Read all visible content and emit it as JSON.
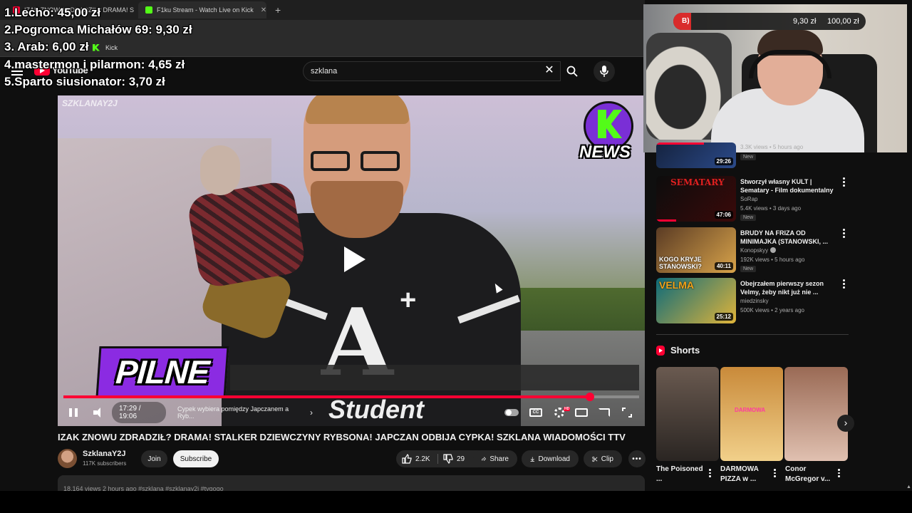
{
  "browser": {
    "tabs": [
      {
        "label": "IZAK ZNOWU ZDRADZIŁ? DRAMA! STALKER",
        "favicon_color": "#ff0033"
      },
      {
        "label": "F1ku Stream - Watch Live on Kick",
        "favicon_color": "#53fc18"
      }
    ],
    "new_tab": "+",
    "bookmarks": [
      {
        "label": "Kick"
      }
    ]
  },
  "donations": [
    "1.Lecho: 45,00 zł",
    "2.Pogromca Michałów 69: 9,30 zł",
    "3. Arab: 6,00 zł",
    "4.mastermon i pilarmon: 4,65 zł",
    "5.Sparto siusionator: 3,70 zł"
  ],
  "youtube": {
    "logo": "YouTube",
    "search": {
      "value": "szklana"
    }
  },
  "player": {
    "watermark": "SZKLANAY2J",
    "news_badge": "NEWS",
    "lower_third": "PILNE",
    "shirt_letter": "A",
    "shirt_plus": "+",
    "shirt_text": "Student",
    "time": "17:29 / 19:06",
    "chapter": "Cypek wybiera pomiędzy Japczanem a Ryb...",
    "progress_fraction": 0.915
  },
  "video": {
    "title": "IZAK ZNOWU ZDRADZIŁ? DRAMA! STALKER DZIEWCZYNY RYBSONA! JAPCZAN ODBIJA CYPKA! SZKLANA WIADOMOŚCI TTV",
    "channel": "SzklanaY2J",
    "subscribers": "117K subscribers",
    "join_label": "Join",
    "subscribe_label": "Subscribe",
    "likes": "2.2K",
    "dislikes": "29",
    "share_label": "Share",
    "download_label": "Download",
    "clip_label": "Clip",
    "description_peek": "18,164 views  2 hours ago  #szklana #szklanay2j #tvgogo"
  },
  "webcam": {
    "bar_label": "B)",
    "amount": "9,30 zł",
    "goal": "100,00 zł",
    "progress_fraction": 0.093
  },
  "recommendations": [
    {
      "title": "",
      "channel": "",
      "meta": "3.3K views • 5 hours ago",
      "badge": "New",
      "duration": "29:26",
      "colors": [
        "#15233f",
        "#2b4a8a"
      ],
      "progress": 0.6
    },
    {
      "title": "Stworzył własny KULT | Sematary - Film dokumentalny",
      "channel": "SoRap",
      "meta": "5.4K views • 3 days ago",
      "badge": "New",
      "duration": "47:06",
      "colors": [
        "#0c0c0c",
        "#8a1010"
      ],
      "progress": 0.25
    },
    {
      "title": "BRUDY NA FRIZA OD MINIMAJKA (STANOWSKI, ...",
      "channel": "Konopskyy",
      "verified": true,
      "meta": "192K views • 5 hours ago",
      "badge": "New",
      "duration": "40:11",
      "colors": [
        "#5a3b24",
        "#d8a34a"
      ],
      "progress": 0
    },
    {
      "title": "Obejrzałem pierwszy sezon Velmy, żeby nikt już nie ...",
      "channel": "miedzinsky",
      "meta": "500K views • 2 years ago",
      "badge": "",
      "duration": "25:12",
      "colors": [
        "#0d6b7a",
        "#e0b43a"
      ],
      "progress": 0
    }
  ],
  "thumb_texts": {
    "sematary": "SEMATARY",
    "kogo": "KOGO KRYJE STANOWSKI?",
    "velma": "VELMA"
  },
  "shorts": {
    "heading": "Shorts",
    "items": [
      {
        "title": "The Poisoned ...",
        "colors": [
          "#5a4a40",
          "#1d1a18"
        ]
      },
      {
        "title": "DARMOWA PIZZA w ...",
        "colors": [
          "#d79a4a",
          "#f3d38a"
        ]
      },
      {
        "title": "Conor McGregor v...",
        "colors": [
          "#8a5a48",
          "#d9b0a0"
        ]
      }
    ],
    "pizza_caption": "DARMOWA"
  }
}
